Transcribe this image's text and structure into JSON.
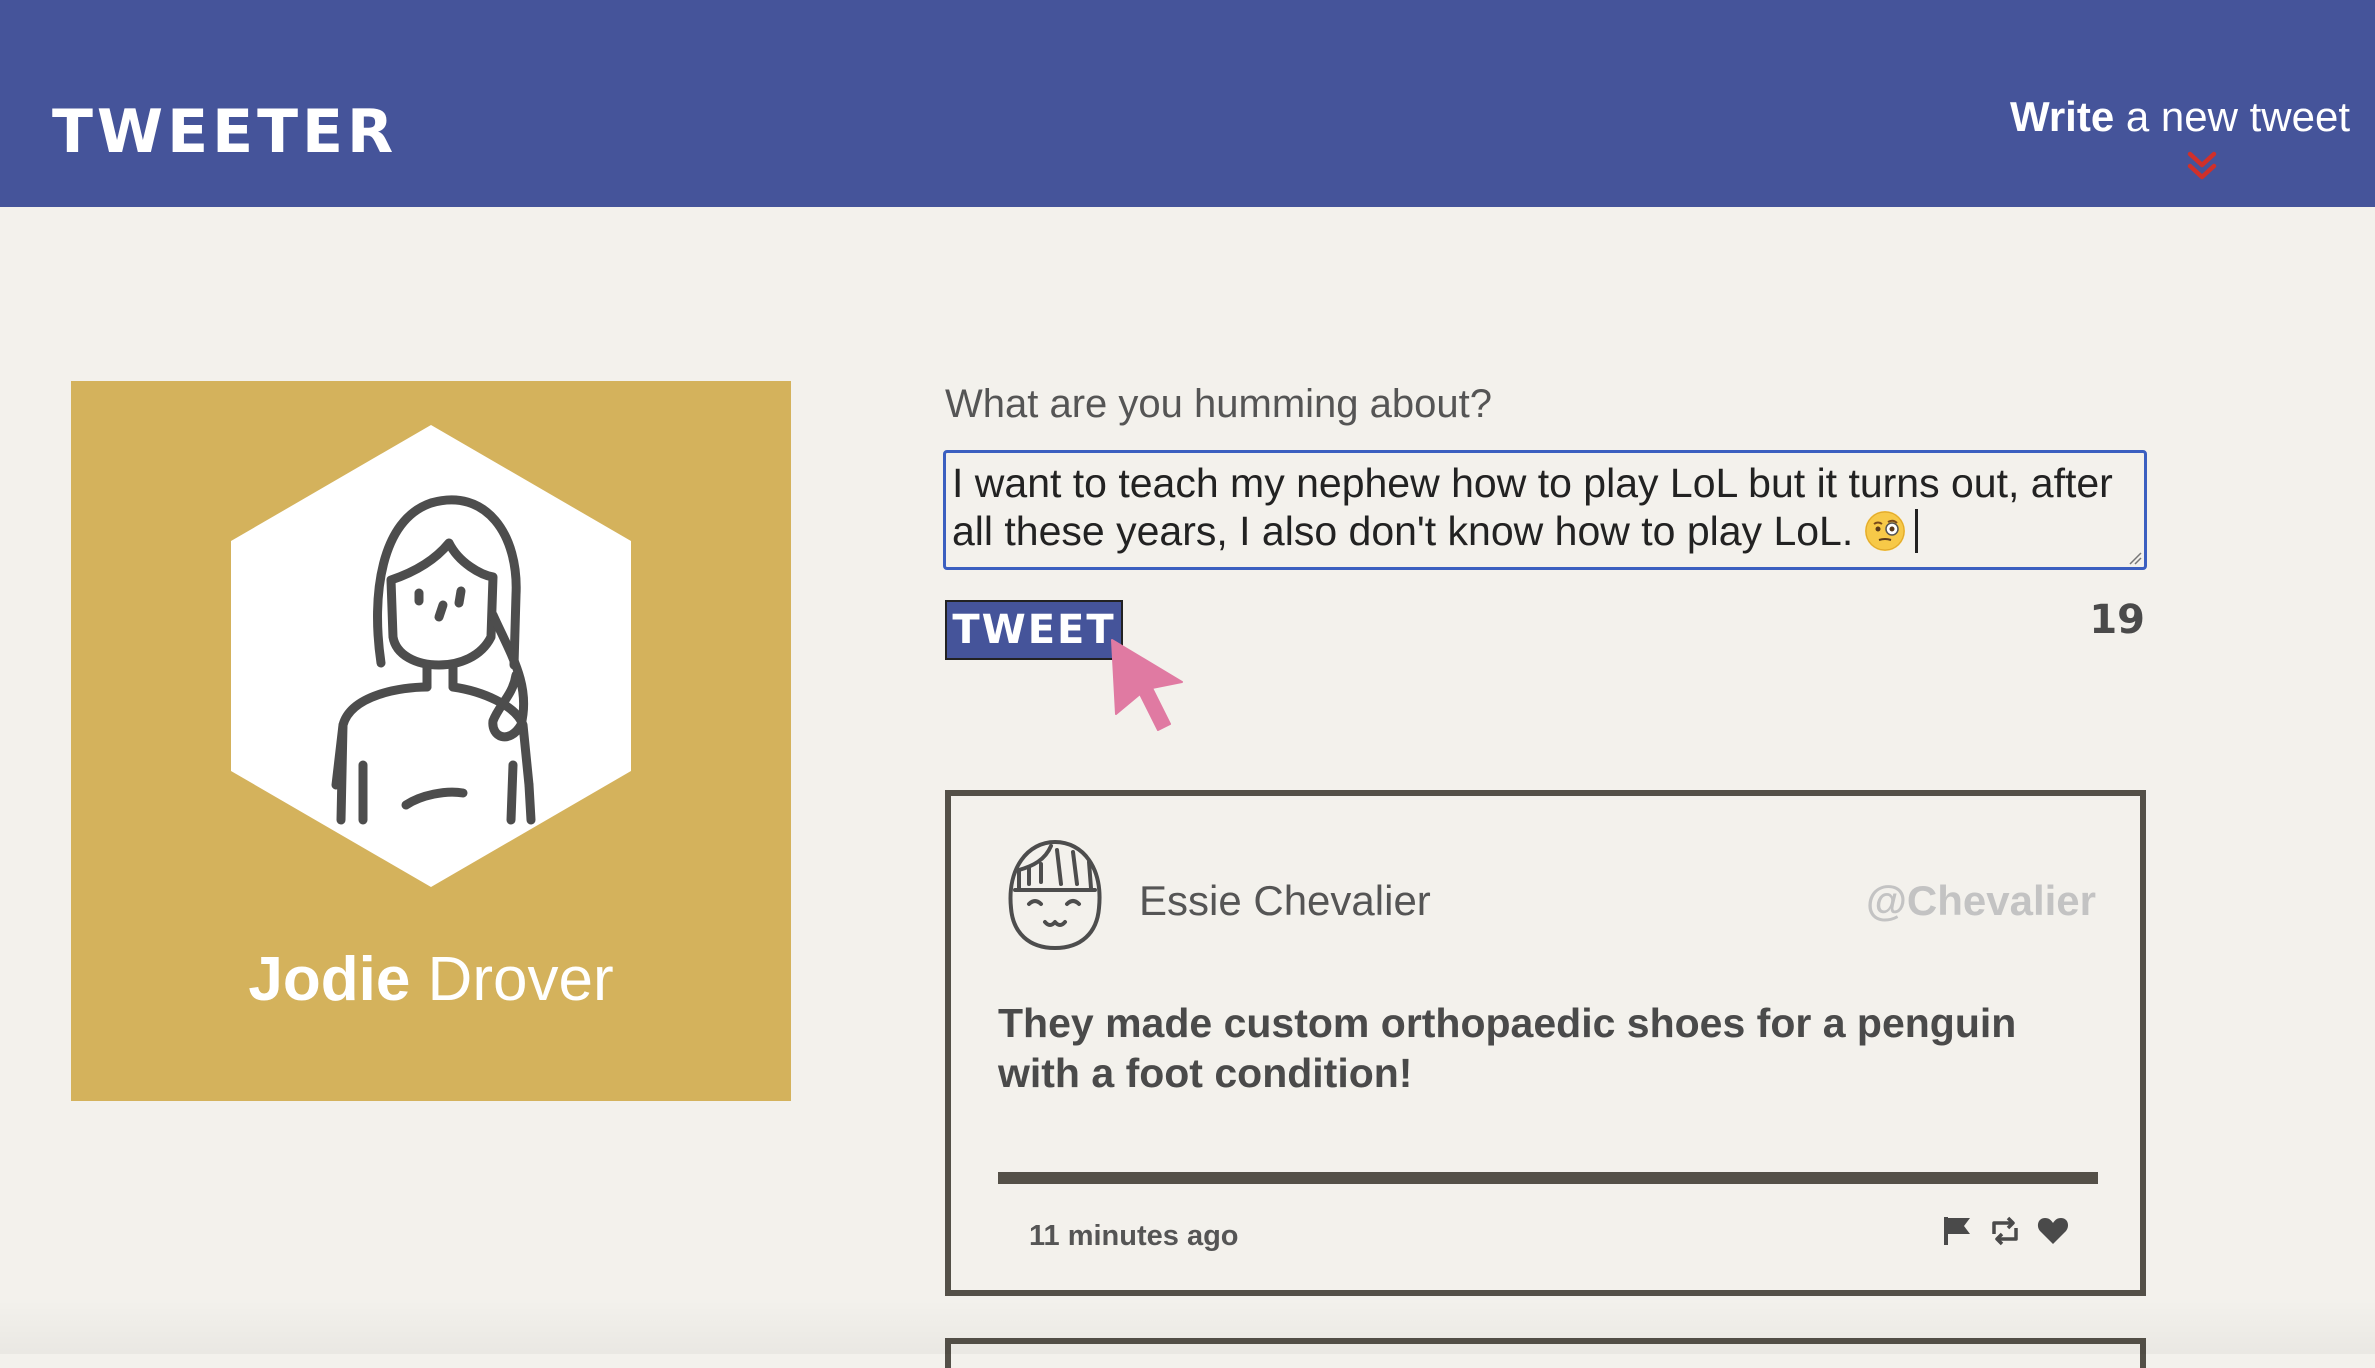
{
  "header": {
    "logo": "TWEETER",
    "write_bold": "Write",
    "write_rest": " a new tweet",
    "arrow_icon": "chevrons-down-icon",
    "background_color": "#45549a",
    "arrow_color": "#d0302a"
  },
  "profile": {
    "first_name": "Jodie",
    "last_name": " Drover",
    "avatar_icon": "user-avatar-icon",
    "card_color": "#d4b25c"
  },
  "compose": {
    "label": "What are you humming about?",
    "text": "I want to teach my nephew how to play LoL but it turns out, after all these years, I also don't know how to play LoL.",
    "emoji_icon": "monocle-face-emoji",
    "tweet_button": "TWEET",
    "char_counter": "19",
    "cursor_icon": "pointer-cursor-icon"
  },
  "tweets": [
    {
      "author": "Essie Chevalier",
      "handle": "@Chevalier",
      "content": "They made custom orthopaedic shoes for a penguin with a foot condition!",
      "time": "11 minutes ago",
      "actions": [
        "flag-icon",
        "retweet-icon",
        "heart-icon"
      ]
    }
  ]
}
